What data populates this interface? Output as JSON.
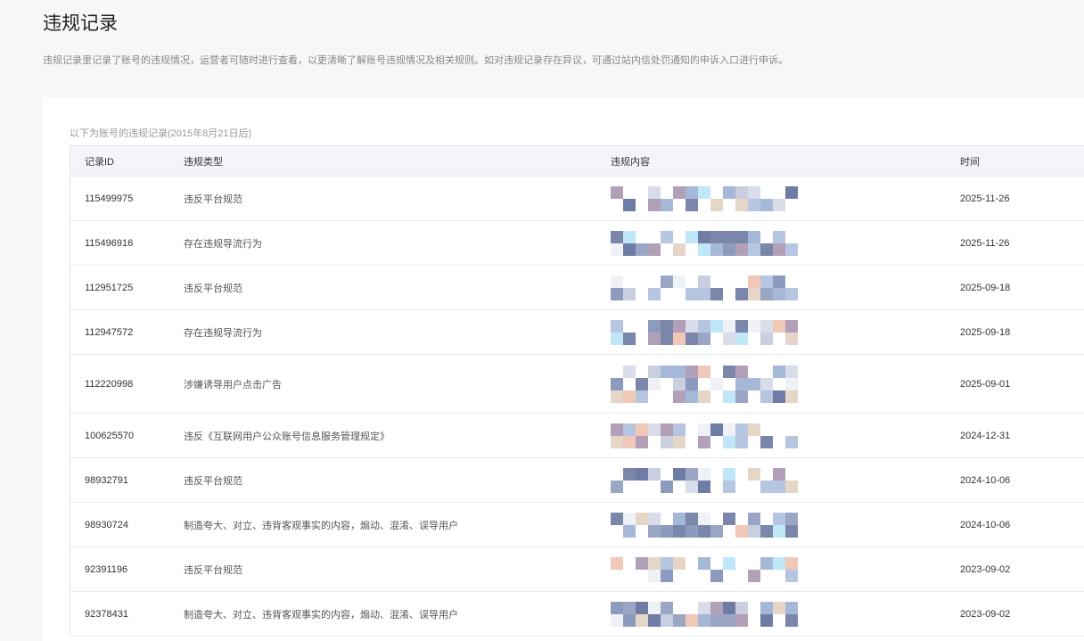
{
  "page_title": "违规记录",
  "description": "违规记录里记录了账号的违规情况，运营者可随时进行查看，以更清晰了解账号违规情况及相关规则。如对违规记录存在异议，可通过站内信处罚通知的申诉入口进行申诉。",
  "subtitle": "以下为账号的违规记录(2015年8月21日后)",
  "columns": [
    "记录ID",
    "违规类型",
    "违规内容",
    "时间"
  ],
  "rows": [
    {
      "id": "115499975",
      "type": "违反平台规范",
      "time": "2025-11-26"
    },
    {
      "id": "115496916",
      "type": "存在违规导流行为",
      "time": "2025-11-26"
    },
    {
      "id": "112951725",
      "type": "违反平台规范",
      "time": "2025-09-18"
    },
    {
      "id": "112947572",
      "type": "存在违规导流行为",
      "time": "2025-09-18"
    },
    {
      "id": "112220998",
      "type": "涉嫌诱导用户点击广告",
      "time": "2025-09-01"
    },
    {
      "id": "100625570",
      "type": "违反《互联网用户公众账号信息服务管理规定》",
      "time": "2024-12-31"
    },
    {
      "id": "98932791",
      "type": "违反平台规范",
      "time": "2024-10-06"
    },
    {
      "id": "98930724",
      "type": "制造夸大、对立、违背客观事实的内容，煽动、混淆、误导用户",
      "time": "2024-10-06"
    },
    {
      "id": "92391196",
      "type": "违反平台规范",
      "time": "2023-09-02"
    },
    {
      "id": "92378431",
      "type": "制造夸大、对立、违背客观事实的内容，煽动、混淆、误导用户",
      "time": "2023-09-02"
    }
  ]
}
